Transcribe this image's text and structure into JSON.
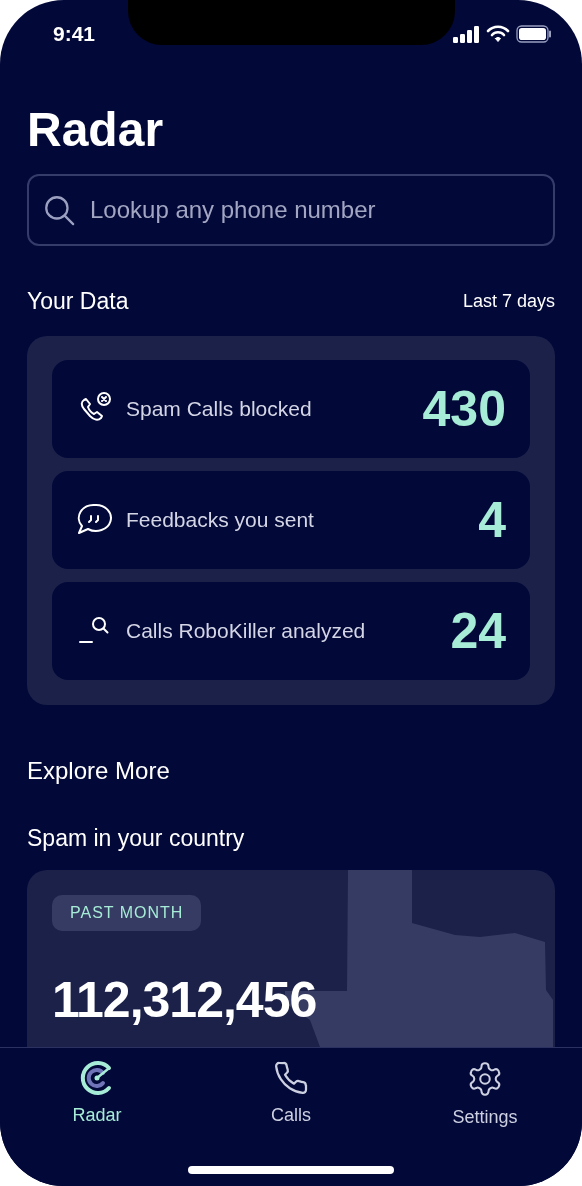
{
  "status_bar": {
    "time": "9:41"
  },
  "title": "Radar",
  "search": {
    "placeholder": "Lookup any phone number"
  },
  "your_data": {
    "heading": "Your Data",
    "range": "Last 7 days",
    "stats": [
      {
        "kind": "blocked",
        "label": "Spam Calls blocked",
        "value": "430"
      },
      {
        "kind": "feedback",
        "label": "Feedbacks you sent",
        "value": "4"
      },
      {
        "kind": "analyzed",
        "label": "Calls RoboKiller analyzed",
        "value": "24"
      }
    ]
  },
  "explore": {
    "heading": "Explore More",
    "subheading": "Spam in your country",
    "card": {
      "badge": "PAST MONTH",
      "number": "112,312,456"
    }
  },
  "tabs": [
    {
      "kind": "radar",
      "label": "Radar",
      "selected": true
    },
    {
      "kind": "calls",
      "label": "Calls",
      "selected": false
    },
    {
      "kind": "settings",
      "label": "Settings",
      "selected": false
    }
  ]
}
